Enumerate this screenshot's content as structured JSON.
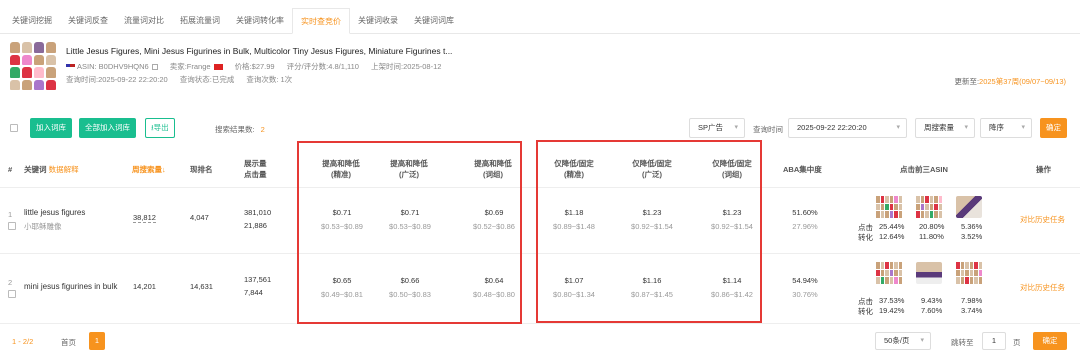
{
  "tabs": [
    {
      "label": "关键词挖掘",
      "active": false
    },
    {
      "label": "关键词反查",
      "active": false
    },
    {
      "label": "流量词对比",
      "active": false
    },
    {
      "label": "拓展流量词",
      "active": false
    },
    {
      "label": "关键词转化率",
      "active": false
    },
    {
      "label": "实时查竞价",
      "active": true
    },
    {
      "label": "关键词收录",
      "active": false
    },
    {
      "label": "关键词词库",
      "active": false
    }
  ],
  "product": {
    "title": "Little Jesus Figures, Mini Jesus Figurines in Bulk, Multicolor Tiny Jesus Figures, Miniature Figurines t...",
    "asin": "ASIN: B0DHV9HQN6",
    "seller": "卖家:Frange",
    "price": "价格:$27.99",
    "rating": "评分/评分数:4.8/1,110",
    "listed": "上架时间:2025-08-12",
    "query_time": "查询时间:2025-09-22 22:20:20",
    "query_status": "查询状态:已完成",
    "query_count": "查询次数: 1次"
  },
  "update": {
    "prefix": "更新至:",
    "value": "2025第37周(09/07~09/13)"
  },
  "toolbar": {
    "add_label": "加入词库",
    "add_all_label": "全部加入词库",
    "export_label": "导出",
    "count_label": "搜索结果数:",
    "count_value": "2",
    "ad_type": "SP广告",
    "query_time_label": "查询时间",
    "query_time_value": "2025-09-22 22:20:20",
    "sort_field": "周搜索量",
    "sort_order": "降序",
    "confirm_label": "确定"
  },
  "headers": {
    "index": "#",
    "keyword": "关键词",
    "keyword_extra": "数据解释",
    "weekly": "周搜索量",
    "rank": "现排名",
    "impr1": "展示量",
    "impr2": "点击量",
    "u_exact_1": "提高和降低",
    "u_exact_2": "(精准)",
    "u_broad_1": "提高和降低",
    "u_broad_2": "(广泛)",
    "u_phrase_1": "提高和降低",
    "u_phrase_2": "(词组)",
    "d_exact_1": "仅降低/固定",
    "d_exact_2": "(精准)",
    "d_broad_1": "仅降低/固定",
    "d_broad_2": "(广泛)",
    "d_phrase_1": "仅降低/固定",
    "d_phrase_2": "(词组)",
    "aba": "ABA集中度",
    "top3": "点击前三ASIN",
    "action": "操作"
  },
  "rows": [
    {
      "index": "1",
      "keyword": "little jesus figures",
      "keyword_cn": "小耶稣雕像",
      "weekly": "38,812",
      "rank": "4,047",
      "impressions": "381,010",
      "clicks": "21,886",
      "u_exact": "$0.71",
      "u_exact_range": "$0.53~$0.89",
      "u_broad": "$0.71",
      "u_broad_range": "$0.53~$0.89",
      "u_phrase": "$0.69",
      "u_phrase_range": "$0.52~$0.86",
      "d_exact": "$1.18",
      "d_exact_range": "$0.89~$1.48",
      "d_broad": "$1.23",
      "d_broad_range": "$0.92~$1.54",
      "d_phrase": "$1.23",
      "d_phrase_range": "$0.92~$1.54",
      "aba_click": "51.60%",
      "aba_conv": "27.96%",
      "click_label": "点击",
      "conv_label": "转化",
      "asin_clicks": [
        "25.44%",
        "20.80%",
        "5.36%"
      ],
      "asin_convs": [
        "12.64%",
        "11.80%",
        "3.52%"
      ],
      "action": "对比历史任务"
    },
    {
      "index": "2",
      "keyword": "mini jesus figurines in bulk",
      "keyword_cn": "",
      "weekly": "14,201",
      "rank": "14,631",
      "impressions": "137,561",
      "clicks": "7,844",
      "u_exact": "$0.65",
      "u_exact_range": "$0.49~$0.81",
      "u_broad": "$0.66",
      "u_broad_range": "$0.50~$0.83",
      "u_phrase": "$0.64",
      "u_phrase_range": "$0.48~$0.80",
      "d_exact": "$1.07",
      "d_exact_range": "$0.80~$1.34",
      "d_broad": "$1.16",
      "d_broad_range": "$0.87~$1.45",
      "d_phrase": "$1.14",
      "d_phrase_range": "$0.86~$1.42",
      "aba_click": "54.94%",
      "aba_conv": "30.76%",
      "click_label": "点击",
      "conv_label": "转化",
      "asin_clicks": [
        "37.53%",
        "9.43%",
        "7.98%"
      ],
      "asin_convs": [
        "19.42%",
        "7.60%",
        "3.74%"
      ],
      "action": "对比历史任务"
    }
  ],
  "pager": {
    "range": "1 - 2/2",
    "first": "首页",
    "current": "1",
    "page_size": "50条/页",
    "jump_label": "跳转至",
    "jump_value": "1",
    "page_unit": "页",
    "confirm": "确定"
  },
  "colors": {
    "accent": "#f7931e",
    "green": "#19be8f",
    "highlight_box": "#e53935"
  }
}
